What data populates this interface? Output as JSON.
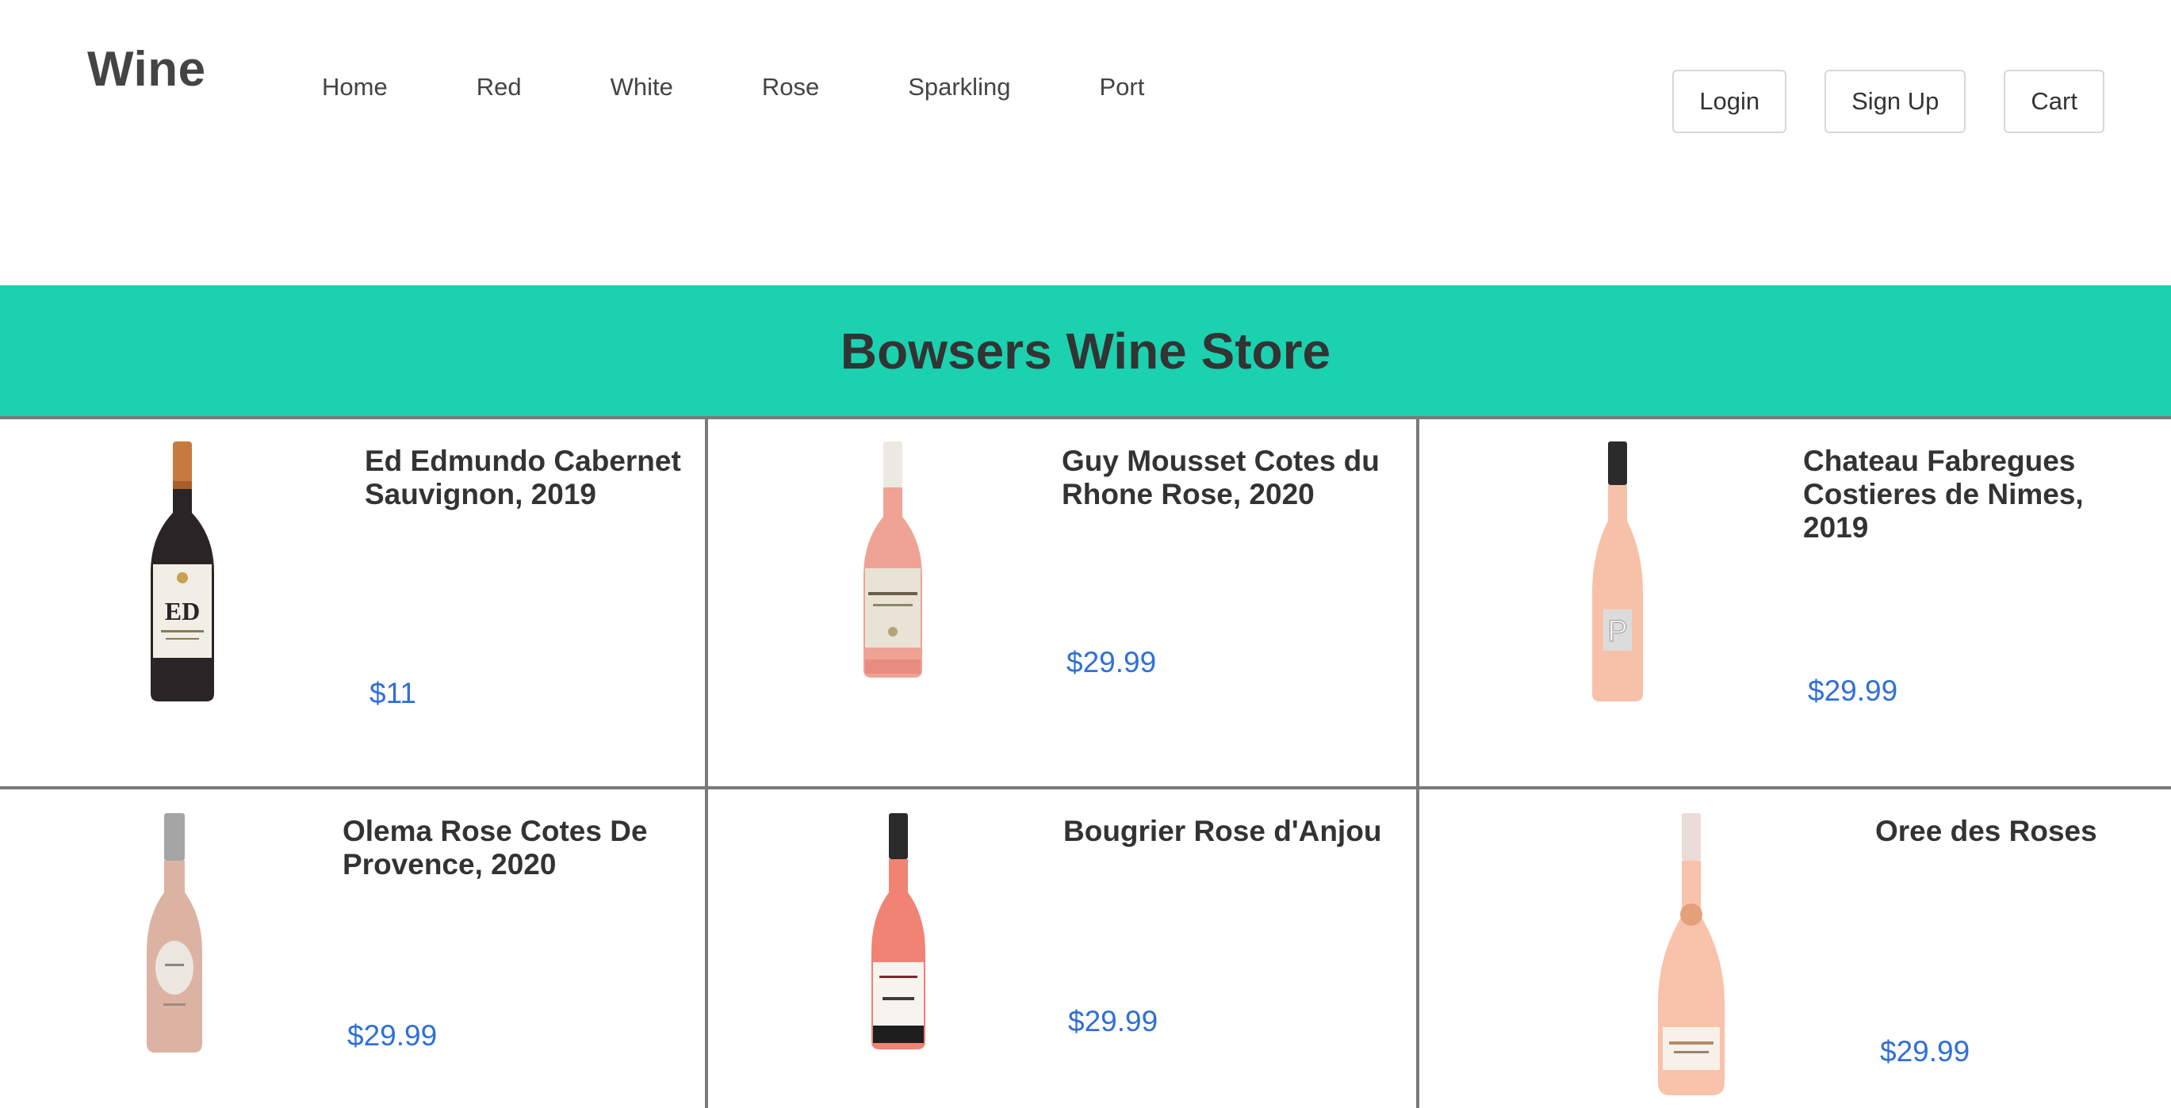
{
  "header": {
    "logo": "Wine",
    "nav": [
      "Home",
      "Red",
      "White",
      "Rose",
      "Sparkling",
      "Port"
    ],
    "buttons": {
      "login": "Login",
      "signup": "Sign Up",
      "cart": "Cart"
    }
  },
  "hero": {
    "title": "Bowsers Wine Store",
    "background": "#1bd1b0"
  },
  "products": [
    {
      "name": "Ed Edmundo Cabernet Sauvignon, 2019",
      "price": "$11",
      "label_text": "ED"
    },
    {
      "name": "Guy Mousset Cotes du Rhone Rose, 2020",
      "price": "$29.99"
    },
    {
      "name": "Chateau Fabregues Costieres de Nimes, 2019",
      "price": "$29.99",
      "label_text": "P"
    },
    {
      "name": "Olema Rose Cotes De Provence, 2020",
      "price": "$29.99"
    },
    {
      "name": "Bougrier Rose d'Anjou",
      "price": "$29.99"
    },
    {
      "name": "Oree des Roses",
      "price": "$29.99"
    }
  ],
  "colors": {
    "accent": "#1bd1b0",
    "price": "#2f6fd8",
    "text": "#333333"
  }
}
